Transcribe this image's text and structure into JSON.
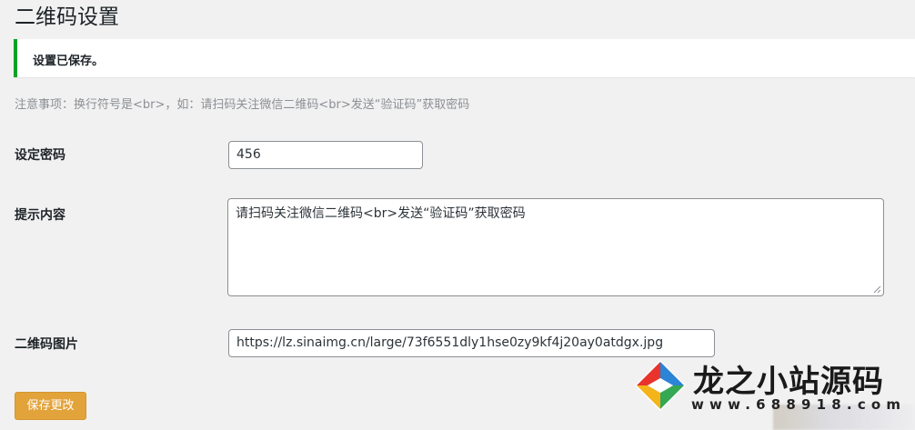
{
  "page": {
    "title": "二维码设置"
  },
  "notice": {
    "text": "设置已保存。",
    "color": "#00a32a"
  },
  "note": {
    "text": "注意事项：换行符号是<br>，如：请扫码关注微信二维码<br>发送“验证码”获取密码"
  },
  "form": {
    "password": {
      "label": "设定密码",
      "value": "456"
    },
    "hint": {
      "label": "提示内容",
      "value": "请扫码关注微信二维码<br>发送“验证码”获取密码"
    },
    "qr_image": {
      "label": "二维码图片",
      "value": "https://lz.sinaimg.cn/large/73f6551dly1hse0zy9kf4j20ay0atdgx.jpg"
    }
  },
  "actions": {
    "save_label": "保存更改",
    "save_color": "#e2a33b"
  },
  "watermark": {
    "title": "龙之小站源码",
    "url": "www.688918.com",
    "logo_icon": "diamond-logo-icon"
  }
}
